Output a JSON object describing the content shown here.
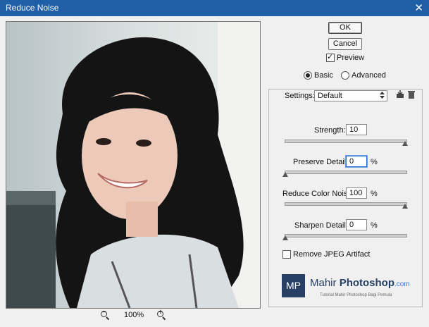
{
  "window": {
    "title": "Reduce Noise",
    "close_glyph": "✕"
  },
  "preview": {
    "zoom_label": "100%",
    "zoom_out_icon": "zoom-out-icon",
    "zoom_in_icon": "zoom-in-icon"
  },
  "buttons": {
    "ok": "OK",
    "cancel": "Cancel"
  },
  "preview_checkbox": {
    "label": "Preview",
    "checked": true
  },
  "mode": {
    "basic_label": "Basic",
    "advanced_label": "Advanced",
    "selected": "Basic"
  },
  "settings": {
    "label": "Settings:",
    "value": "Default",
    "save_icon": "save-preset-icon",
    "delete_icon": "trash-icon"
  },
  "strength": {
    "label": "Strength:",
    "value": "10",
    "slider_fraction": 1.0
  },
  "preserve_details": {
    "label": "Preserve Details:",
    "value": "0",
    "unit": "%",
    "slider_fraction": 0.0
  },
  "reduce_color_noise": {
    "label": "Reduce Color Noise:",
    "value": "100",
    "unit": "%",
    "slider_fraction": 1.0
  },
  "sharpen_details": {
    "label": "Sharpen Details:",
    "value": "0",
    "unit": "%",
    "slider_fraction": 0.0
  },
  "remove_jpeg": {
    "label": "Remove JPEG Artifact",
    "checked": false
  },
  "watermark": {
    "mark": "MP",
    "brand_part1": "Mahir ",
    "brand_part2": "Photoshop",
    "brand_domain": ".com",
    "tagline": "Tutorial Mahir Photoshop Bagi Pemula"
  }
}
